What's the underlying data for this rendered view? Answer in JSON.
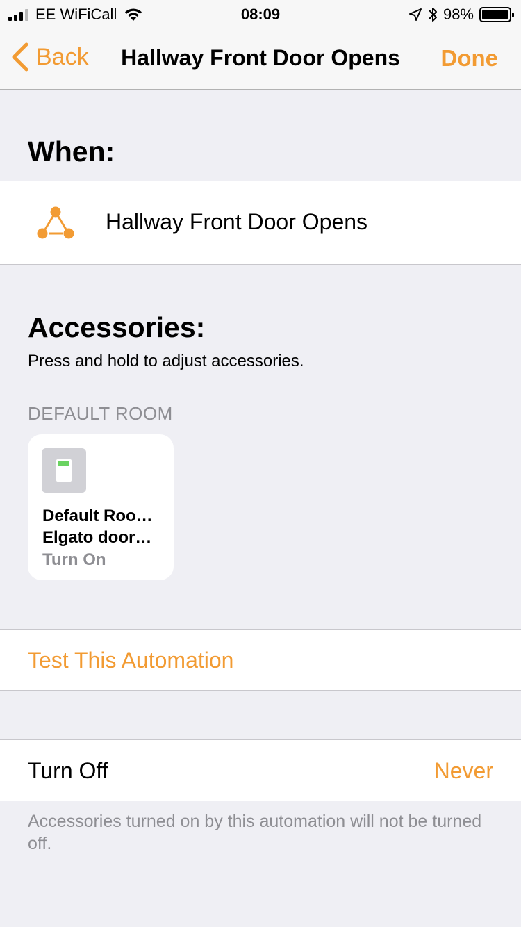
{
  "status_bar": {
    "carrier": "EE WiFiCall",
    "time": "08:09",
    "battery_percent": "98%",
    "battery_level": 0.98,
    "signal_bars_filled": 3,
    "signal_bars_total": 4,
    "icons": [
      "signal-icon",
      "wifi-icon",
      "location-arrow-icon",
      "bluetooth-icon",
      "battery-icon"
    ]
  },
  "nav": {
    "back_label": "Back",
    "title": "Hallway Front Door Opens",
    "done_label": "Done"
  },
  "when": {
    "heading": "When:",
    "trigger_label": "Hallway Front Door Opens",
    "trigger_icon": "automation-trigger-icon"
  },
  "accessories": {
    "heading": "Accessories:",
    "subtext": "Press and hold to adjust accessories.",
    "room_header": "DEFAULT ROOM",
    "tiles": [
      {
        "line1": "Default Roo…",
        "line2": "Elgato door…",
        "status": "Turn On",
        "icon": "switch-icon"
      }
    ]
  },
  "test": {
    "label": "Test This Automation"
  },
  "turn_off": {
    "label": "Turn Off",
    "value": "Never",
    "footnote": "Accessories turned on by this automation will not be turned off."
  },
  "colors": {
    "accent": "#f29b33",
    "background": "#efeff4",
    "secondary_text": "#8e8e93",
    "switch_led": "#6ad361"
  }
}
